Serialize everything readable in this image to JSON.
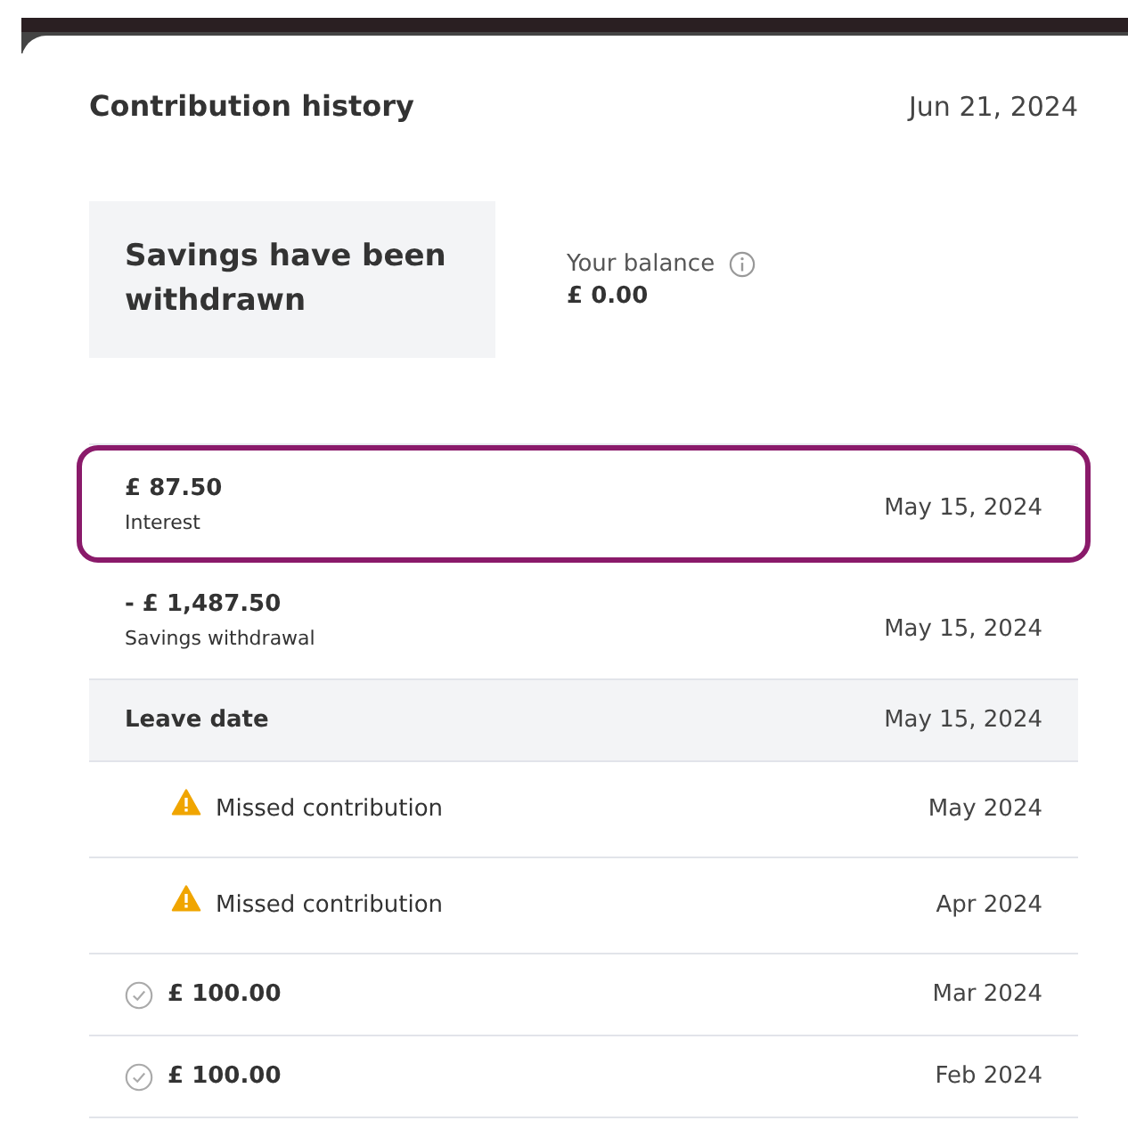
{
  "header": {
    "title": "Contribution history",
    "date": "Jun 21, 2024"
  },
  "status": {
    "message": "Savings have been withdrawn",
    "balance_label": "Your balance",
    "balance": "£ 0.00"
  },
  "rows": [
    {
      "kind": "transaction",
      "amount": "£ 87.50",
      "description": "Interest",
      "date": "May 15, 2024",
      "highlighted": true
    },
    {
      "kind": "transaction",
      "amount": "- £ 1,487.50",
      "description": "Savings withdrawal",
      "date": "May 15, 2024",
      "highlighted": false
    },
    {
      "kind": "leave",
      "label": "Leave date",
      "date": "May 15, 2024",
      "highlighted": false
    },
    {
      "kind": "missed",
      "label": "Missed contribution",
      "date": "May 2024",
      "highlighted": false
    },
    {
      "kind": "missed",
      "label": "Missed contribution",
      "date": "Apr 2024",
      "highlighted": false
    },
    {
      "kind": "paid",
      "amount": "£ 100.00",
      "date": "Mar 2024",
      "highlighted": false
    },
    {
      "kind": "paid",
      "amount": "£ 100.00",
      "date": "Feb 2024",
      "highlighted": false
    }
  ]
}
